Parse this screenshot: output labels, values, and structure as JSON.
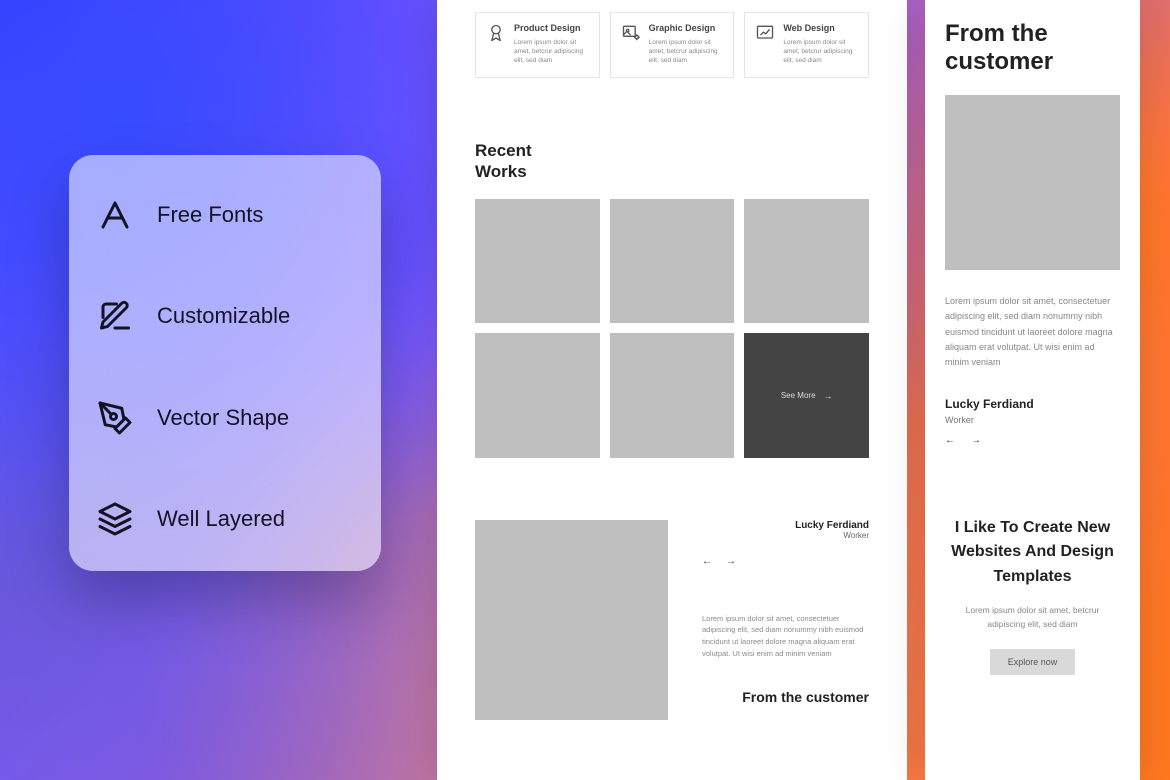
{
  "features": [
    {
      "label": "Free Fonts"
    },
    {
      "label": "Customizable"
    },
    {
      "label": "Vector Shape"
    },
    {
      "label": "Well Layered"
    }
  ],
  "centerPanel": {
    "services": [
      {
        "title": "Product Design",
        "sub": "Lorem ipsum dolor sit amet, betcrur adipiscing elit, sed diam"
      },
      {
        "title": "Graphic Design",
        "sub": "Lorem ipsum dolor sit amet, betcrur adipiscing elit, sed diam"
      },
      {
        "title": "Web Design",
        "sub": "Lorem ipsum dolor sit amet, betcrur adipiscing elit, sed diam"
      }
    ],
    "recentWorks": {
      "title": "Recent Works",
      "seeMore": "See More"
    },
    "testimonial": {
      "name": "Lucky Ferdiand",
      "role": "Worker",
      "quote": "Lorem ipsum dolor sit amet, consectetuer adipiscing elit, sed diam nonummy nibh euismod tincidunt ut laoreet dolore magna aliquam erat volutpat. Ut wisi enim ad minim veniam",
      "fromCustomer": "From the customer"
    }
  },
  "rightPanel": {
    "title": "From the customer",
    "testimonial": {
      "quote": "Lorem ipsum dolor sit amet, consectetuer adipiscing elit, sed diam nonummy nibh euismod tincidunt ut laoreet dolore magna aliquam erat volutpat. Ut wisi enim ad minim veniam",
      "name": "Lucky Ferdiand",
      "role": "Worker"
    },
    "cta": {
      "title": "I Like To Create New Websites And Design Templates",
      "sub": "Lorem ipsum dolor sit amet, betcrur adipiscing elit, sed diam",
      "button": "Explore now"
    }
  }
}
